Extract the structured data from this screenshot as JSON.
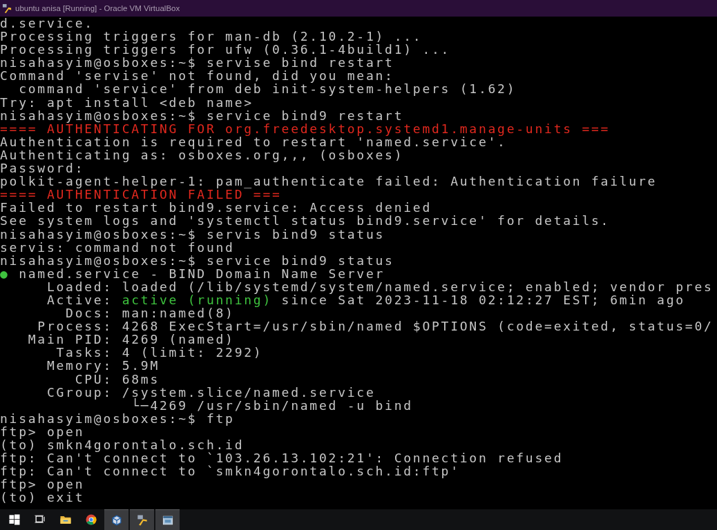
{
  "window": {
    "title": "ubuntu anisa [Running] - Oracle VM VirtualBox"
  },
  "terminal": {
    "lines": [
      {
        "segments": [
          {
            "text": "d.service.",
            "kind": "plain"
          }
        ]
      },
      {
        "segments": [
          {
            "text": "Processing triggers for man-db (2.10.2-1) ...",
            "kind": "plain"
          }
        ]
      },
      {
        "segments": [
          {
            "text": "Processing triggers for ufw (0.36.1-4build1) ...",
            "kind": "plain"
          }
        ]
      },
      {
        "segments": [
          {
            "text": "nisahasyim@osboxes:~$ servise bind restart",
            "kind": "plain"
          }
        ]
      },
      {
        "segments": [
          {
            "text": "Command 'servise' not found, did you mean:",
            "kind": "plain"
          }
        ]
      },
      {
        "segments": [
          {
            "text": "  command 'service' from deb init-system-helpers (1.62)",
            "kind": "plain"
          }
        ]
      },
      {
        "segments": [
          {
            "text": "Try: apt install <deb name>",
            "kind": "plain"
          }
        ]
      },
      {
        "segments": [
          {
            "text": "nisahasyim@osboxes:~$ service bind9 restart",
            "kind": "plain"
          }
        ]
      },
      {
        "segments": [
          {
            "text": "==== AUTHENTICATING FOR org.freedesktop.systemd1.manage-units ===",
            "kind": "alert"
          }
        ]
      },
      {
        "segments": [
          {
            "text": "Authentication is required to restart 'named.service'.",
            "kind": "plain"
          }
        ]
      },
      {
        "segments": [
          {
            "text": "Authenticating as: osboxes.org,,, (osboxes)",
            "kind": "plain"
          }
        ]
      },
      {
        "segments": [
          {
            "text": "Password:",
            "kind": "plain"
          }
        ]
      },
      {
        "segments": [
          {
            "text": "polkit-agent-helper-1: pam_authenticate failed: Authentication failure",
            "kind": "plain"
          }
        ]
      },
      {
        "segments": [
          {
            "text": "==== AUTHENTICATION FAILED ===",
            "kind": "alert"
          }
        ]
      },
      {
        "segments": [
          {
            "text": "Failed to restart bind9.service: Access denied",
            "kind": "plain"
          }
        ]
      },
      {
        "segments": [
          {
            "text": "See system logs and 'systemctl status bind9.service' for details.",
            "kind": "plain"
          }
        ]
      },
      {
        "segments": [
          {
            "text": "nisahasyim@osboxes:~$ servis bind9 status",
            "kind": "plain"
          }
        ]
      },
      {
        "segments": [
          {
            "text": "servis: command not found",
            "kind": "plain"
          }
        ]
      },
      {
        "segments": [
          {
            "text": "nisahasyim@osboxes:~$ service bind9 status",
            "kind": "plain"
          }
        ]
      },
      {
        "segments": [
          {
            "text": "●",
            "kind": "ok"
          },
          {
            "text": " named.service - BIND Domain Name Server",
            "kind": "plain"
          }
        ]
      },
      {
        "segments": [
          {
            "text": "     Loaded: loaded (/lib/systemd/system/named.service; enabled; vendor pres",
            "kind": "plain"
          }
        ]
      },
      {
        "segments": [
          {
            "text": "     Active: ",
            "kind": "plain"
          },
          {
            "text": "active (running)",
            "kind": "ok"
          },
          {
            "text": " since Sat 2023-11-18 02:12:27 EST; 6min ago",
            "kind": "plain"
          }
        ]
      },
      {
        "segments": [
          {
            "text": "       Docs: man:named(8)",
            "kind": "plain"
          }
        ]
      },
      {
        "segments": [
          {
            "text": "    Process: 4268 ExecStart=/usr/sbin/named $OPTIONS (code=exited, status=0/",
            "kind": "plain"
          }
        ]
      },
      {
        "segments": [
          {
            "text": "   Main PID: 4269 (named)",
            "kind": "plain"
          }
        ]
      },
      {
        "segments": [
          {
            "text": "      Tasks: 4 (limit: 2292)",
            "kind": "plain"
          }
        ]
      },
      {
        "segments": [
          {
            "text": "     Memory: 5.9M",
            "kind": "plain"
          }
        ]
      },
      {
        "segments": [
          {
            "text": "        CPU: 68ms",
            "kind": "plain"
          }
        ]
      },
      {
        "segments": [
          {
            "text": "     CGroup: /system.slice/named.service",
            "kind": "plain"
          }
        ]
      },
      {
        "segments": [
          {
            "text": "              └─4269 /usr/sbin/named -u bind",
            "kind": "plain"
          }
        ]
      },
      {
        "segments": [
          {
            "text": "nisahasyim@osboxes:~$ ftp",
            "kind": "plain"
          }
        ]
      },
      {
        "segments": [
          {
            "text": "ftp> open",
            "kind": "plain"
          }
        ]
      },
      {
        "segments": [
          {
            "text": "(to) smkn4gorontalo.sch.id",
            "kind": "plain"
          }
        ]
      },
      {
        "segments": [
          {
            "text": "ftp: Can't connect to `103.26.13.102:21': Connection refused",
            "kind": "plain"
          }
        ]
      },
      {
        "segments": [
          {
            "text": "ftp: Can't connect to `smkn4gorontalo.sch.id:ftp'",
            "kind": "plain"
          }
        ]
      },
      {
        "segments": [
          {
            "text": "ftp> open",
            "kind": "plain"
          }
        ]
      },
      {
        "segments": [
          {
            "text": "(to) exit",
            "kind": "plain"
          }
        ]
      }
    ]
  },
  "taskbar": {
    "items": [
      {
        "kind": "start",
        "open": false
      },
      {
        "kind": "taskview",
        "open": false
      },
      {
        "kind": "folder",
        "open": false
      },
      {
        "kind": "browser",
        "open": false
      },
      {
        "kind": "cube",
        "open": true
      },
      {
        "kind": "vbox",
        "open": true
      },
      {
        "kind": "window",
        "open": true
      }
    ]
  }
}
